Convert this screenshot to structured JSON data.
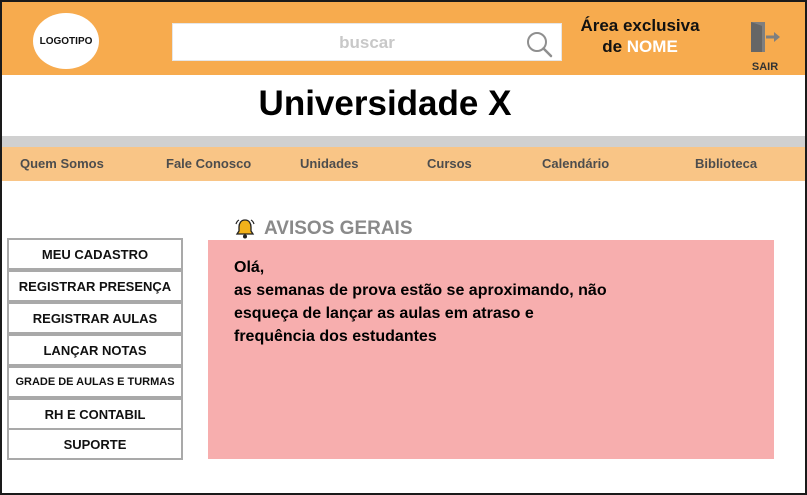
{
  "header": {
    "logo_text": "LOGOTIPO",
    "search_placeholder": "buscar",
    "exclusive_prefix": "Área exclusiva",
    "exclusive_de": "de",
    "user_name": "NOME",
    "logout_label": "SAIR",
    "icons": {
      "search": "search-icon",
      "logout": "logout-door-icon"
    }
  },
  "title": "Universidade X",
  "nav": {
    "items": [
      "Quem Somos",
      "Fale Conosco",
      "Unidades",
      "Cursos",
      "Calendário",
      "Biblioteca"
    ]
  },
  "side_menu": {
    "items": [
      "MEU CADASTRO",
      "REGISTRAR PRESENÇA",
      "REGISTRAR AULAS",
      "LANÇAR NOTAS",
      "GRADE DE AULAS E TURMAS",
      "RH E CONTABIL",
      "SUPORTE"
    ]
  },
  "notices": {
    "heading": "AVISOS GERAIS",
    "icon": "bell-icon",
    "lines": [
      "Olá,",
      "as semanas de prova estão se aproximando, não",
      "esqueça de lançar as aulas em atraso e",
      "frequência dos estudantes"
    ]
  },
  "colors": {
    "header_bg": "#f7ab4e",
    "nav_bg": "#f9c586",
    "notice_bg": "#f7aeae",
    "accent_white": "#ffffff"
  }
}
